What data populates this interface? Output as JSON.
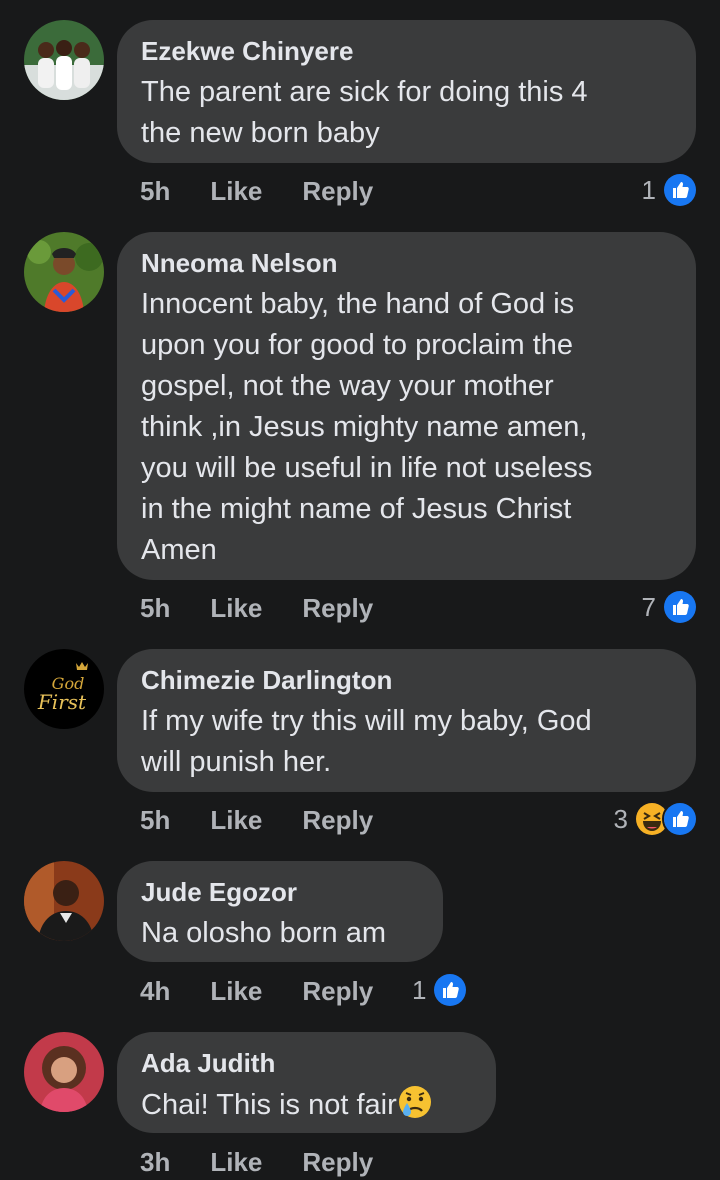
{
  "comments": [
    {
      "author": "Ezekwe Chinyere",
      "text": "The parent are sick for doing this 4\nthe new born baby",
      "time": "5h",
      "like_label": "Like",
      "reply_label": "Reply",
      "reaction_count": "1",
      "reactions": [
        "like-icon"
      ]
    },
    {
      "author": "Nneoma Nelson",
      "text": "Innocent baby, the hand of God is\nupon you for good to proclaim the\ngospel, not the way your mother\nthink ,in Jesus mighty name amen,\nyou will be useful in life not useless\nin the might name of Jesus Christ\nAmen",
      "time": "5h",
      "like_label": "Like",
      "reply_label": "Reply",
      "reaction_count": "7",
      "reactions": [
        "like-icon"
      ]
    },
    {
      "author": "Chimezie Darlington",
      "text": "If my wife try this will my baby, God\nwill punish her.",
      "time": "5h",
      "like_label": "Like",
      "reply_label": "Reply",
      "reaction_count": "3",
      "reactions": [
        "haha-icon",
        "like-icon"
      ],
      "avatar_text_1": "God",
      "avatar_text_2": "First"
    },
    {
      "author": "Jude Egozor",
      "text": "Na olosho born am",
      "time": "4h",
      "like_label": "Like",
      "reply_label": "Reply",
      "reaction_count": "1",
      "reactions": [
        "like-icon"
      ]
    },
    {
      "author": "Ada Judith",
      "text": "Chai! This is not fair",
      "text_emoji": "sad-tear-emoji",
      "time": "3h",
      "like_label": "Like",
      "reply_label": "Reply"
    }
  ],
  "colors": {
    "background": "#18191a",
    "bubble": "#3a3b3c",
    "text": "#e4e6eb",
    "secondary": "#b0b3b8",
    "like_blue": "#1877f2",
    "haha_yellow": "#f7b125"
  }
}
